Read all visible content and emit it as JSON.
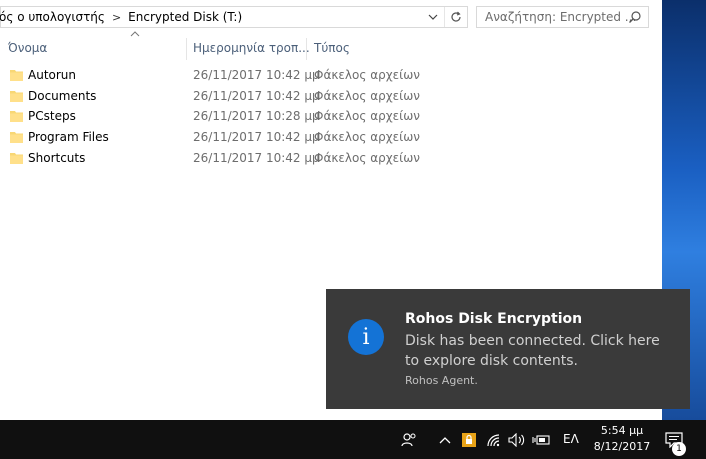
{
  "address": {
    "crumbs": [
      "ός ο υπολογιστής",
      "Encrypted Disk (T:)"
    ],
    "separator": ">"
  },
  "search": {
    "placeholder": "Αναζήτηση: Encrypted ..."
  },
  "columns": {
    "name": "Όνομα",
    "date": "Ημερομηνία τροπ...",
    "type": "Τύπος"
  },
  "files": [
    {
      "name": "Autorun",
      "date": "26/11/2017 10:42 μμ",
      "type": "Φάκελος αρχείων"
    },
    {
      "name": "Documents",
      "date": "26/11/2017 10:42 μμ",
      "type": "Φάκελος αρχείων"
    },
    {
      "name": "PCsteps",
      "date": "26/11/2017 10:28 μμ",
      "type": "Φάκελος αρχείων"
    },
    {
      "name": "Program Files",
      "date": "26/11/2017 10:42 μμ",
      "type": "Φάκελος αρχείων"
    },
    {
      "name": "Shortcuts",
      "date": "26/11/2017 10:42 μμ",
      "type": "Φάκελος αρχείων"
    }
  ],
  "toast": {
    "icon_glyph": "i",
    "title": "Rohos Disk Encryption",
    "body": "Disk has been connected. Click here to explore disk contents.",
    "source": "Rohos Agent."
  },
  "taskbar": {
    "language": "ΕΛ",
    "time": "5:54 μμ",
    "date": "8/12/2017",
    "notification_count": "1"
  },
  "colors": {
    "folder": "#f8d775",
    "toast_bg": "#3a3a3a",
    "toast_icon": "#1473d6",
    "taskbar_bg": "#101010"
  }
}
